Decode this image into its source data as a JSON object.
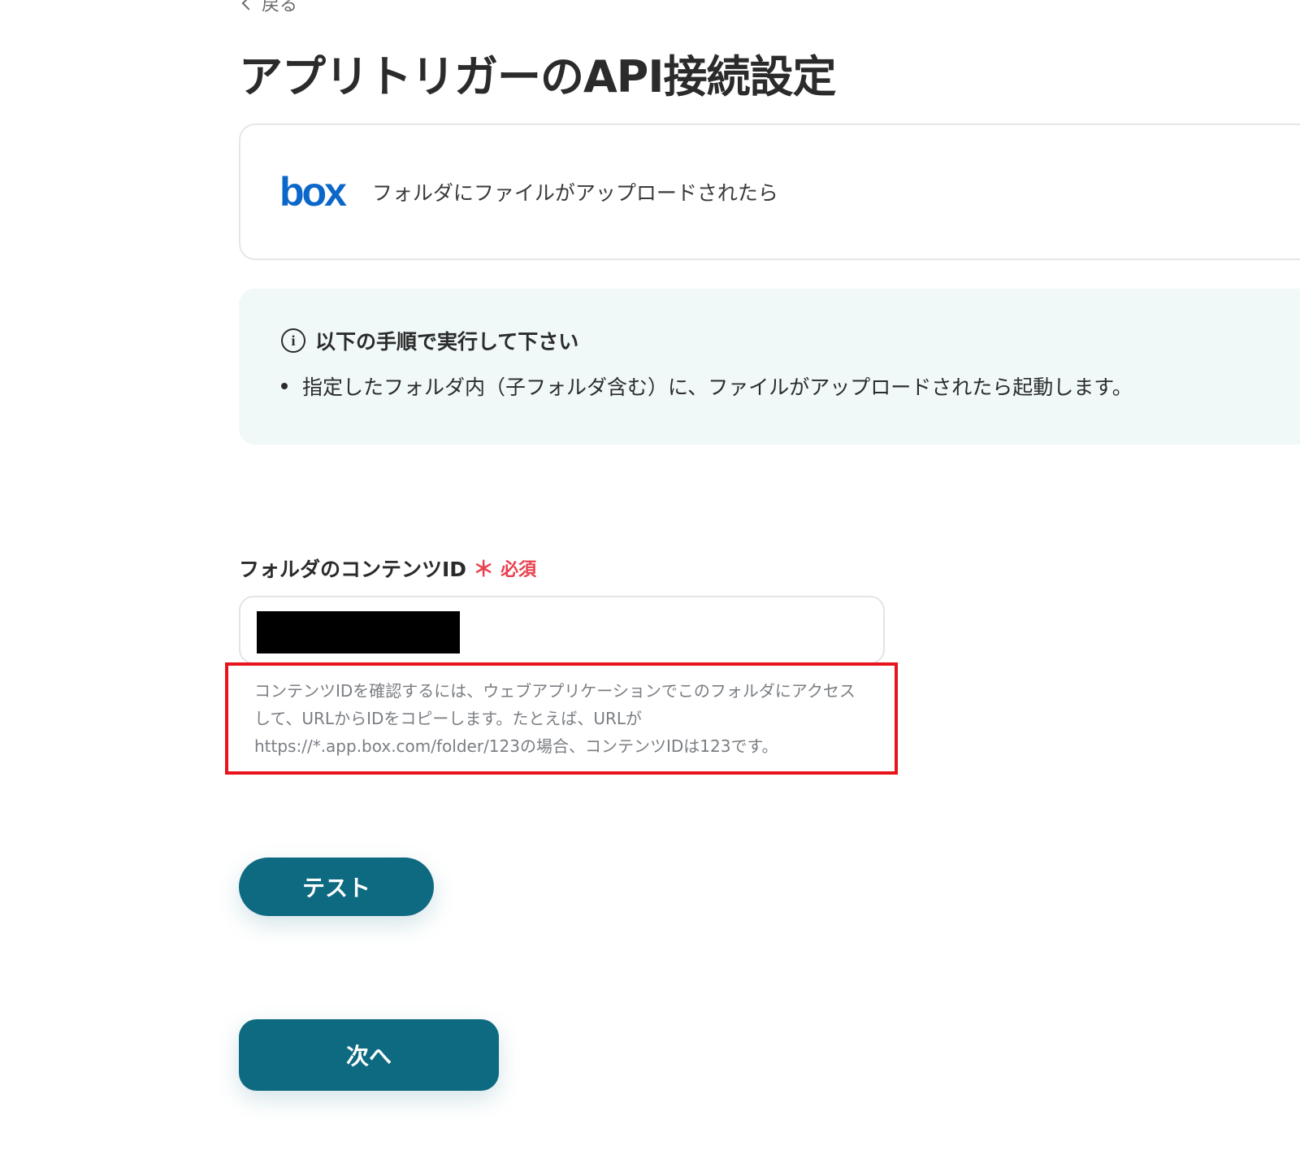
{
  "nav": {
    "back_label": "戻る"
  },
  "header": {
    "title": "アプリトリガーのAPI接続設定"
  },
  "trigger": {
    "app_logo_text": "box",
    "label": "フォルダにファイルがアップロードされたら"
  },
  "info": {
    "heading": "以下の手順で実行して下さい",
    "items": [
      "指定したフォルダ内（子フォルダ含む）に、ファイルがアップロードされたら起動します。"
    ]
  },
  "form": {
    "folder_id": {
      "label": "フォルダのコンテンツID",
      "required_mark": "＊",
      "required_text": "必須",
      "help_lines": [
        "コンテンツIDを確認するには、ウェブアプリケーションでこのフォルダにアクセス",
        "して、URLからIDをコピーします。たとえば、URLが",
        "https://*.app.box.com/folder/123の場合、コンテンツIDは123です。"
      ]
    }
  },
  "actions": {
    "test_label": "テスト",
    "next_label": "次へ"
  },
  "colors": {
    "primary": "#0e6a80",
    "required": "#e8414f",
    "highlight_border": "#e8141b",
    "info_bg": "#f0f8f8",
    "box_brand": "#0b67c9"
  }
}
